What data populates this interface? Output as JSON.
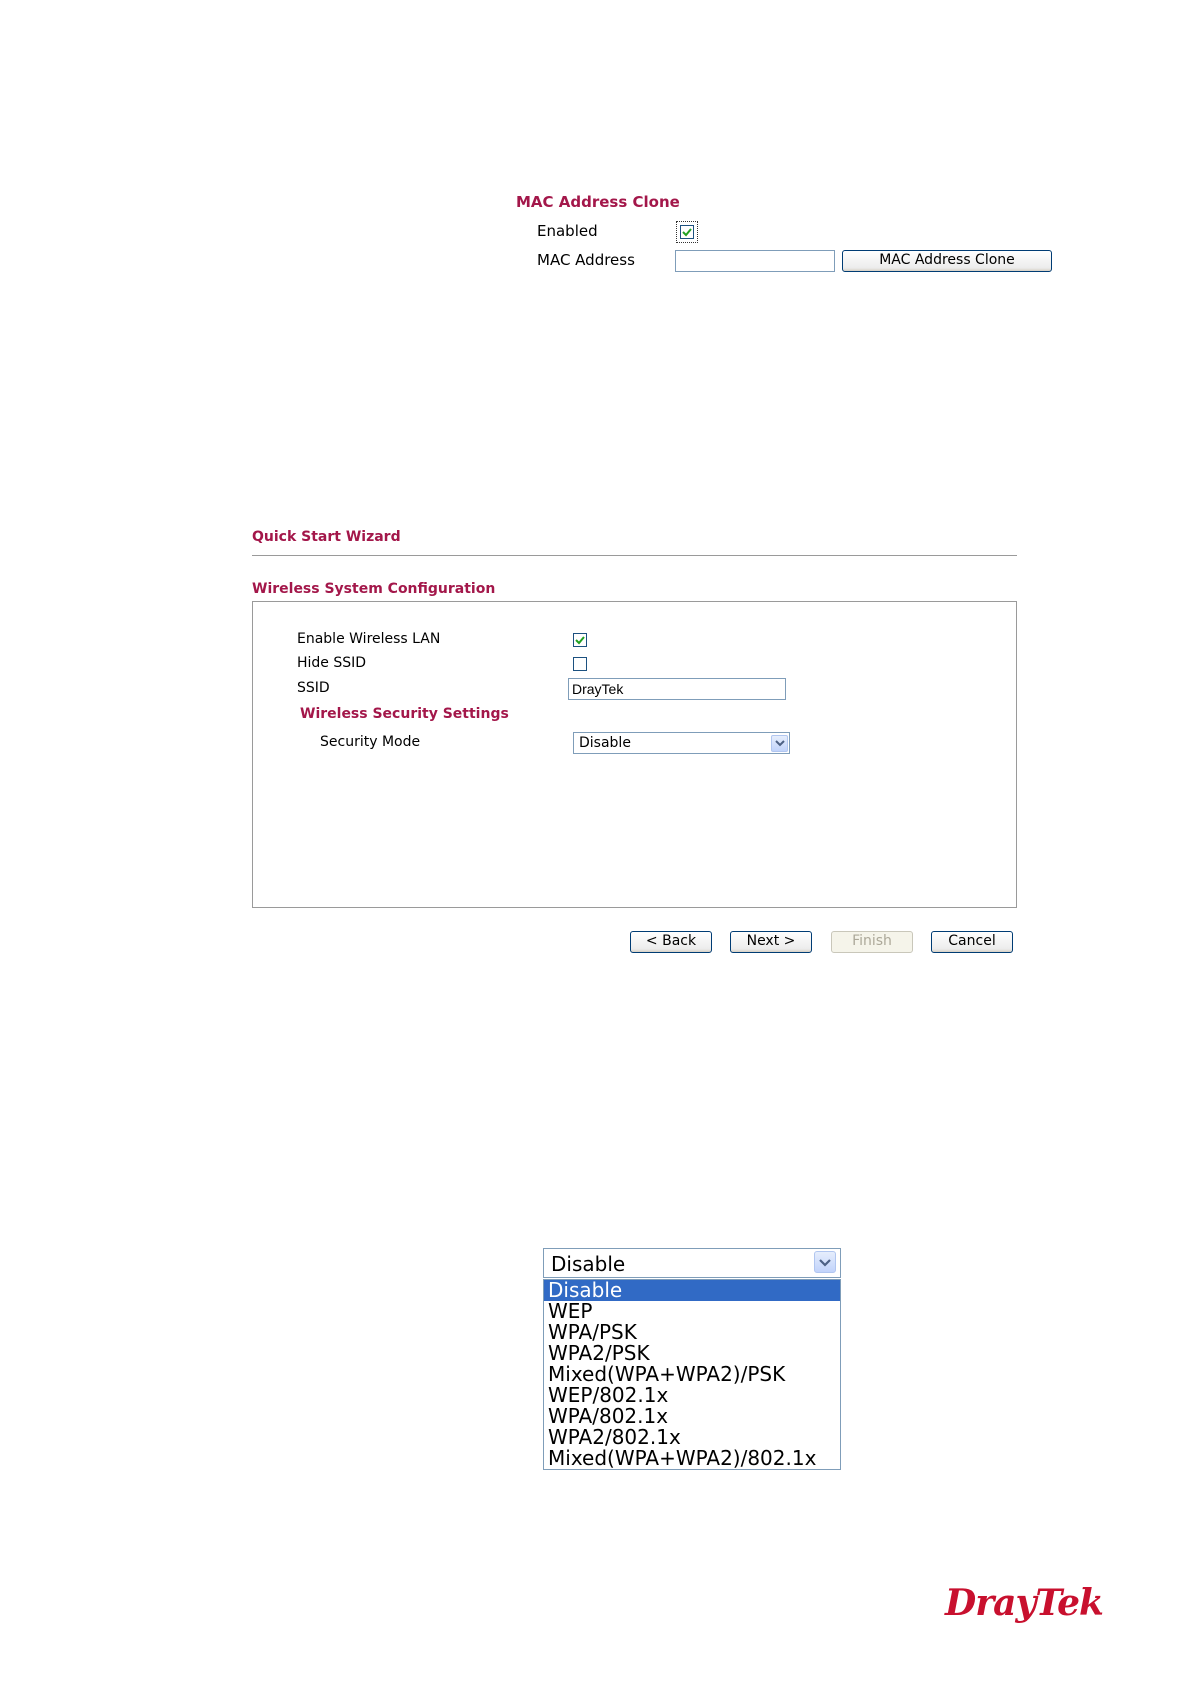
{
  "mac_clone": {
    "title": "MAC Address Clone",
    "enabled_label": "Enabled",
    "enabled_checked": true,
    "mac_address_label": "MAC Address",
    "mac_address_value": "",
    "clone_button_label": "MAC Address Clone"
  },
  "wizard": {
    "title": "Quick Start Wizard",
    "section_title": "Wireless System Configuration",
    "enable_wlan_label": "Enable Wireless LAN",
    "enable_wlan_checked": true,
    "hide_ssid_label": "Hide SSID",
    "hide_ssid_checked": false,
    "ssid_label": "SSID",
    "ssid_value": "DrayTek",
    "security_settings_title": "Wireless Security Settings",
    "security_mode_label": "Security Mode",
    "security_mode_value": "Disable",
    "buttons": {
      "back": "< Back",
      "next": "Next >",
      "finish": "Finish",
      "cancel": "Cancel"
    }
  },
  "security_dropdown": {
    "current_value": "Disable",
    "options": [
      "Disable",
      "WEP",
      "WPA/PSK",
      "WPA2/PSK",
      "Mixed(WPA+WPA2)/PSK",
      "WEP/802.1x",
      "WPA/802.1x",
      "WPA2/802.1x",
      "Mixed(WPA+WPA2)/802.1x"
    ],
    "highlighted_option": "Disable"
  },
  "logo": {
    "text": "DrayTek"
  },
  "colors": {
    "title_red": "#a3174a",
    "selection_blue": "#316ac5",
    "logo_red": "#c8102e"
  }
}
